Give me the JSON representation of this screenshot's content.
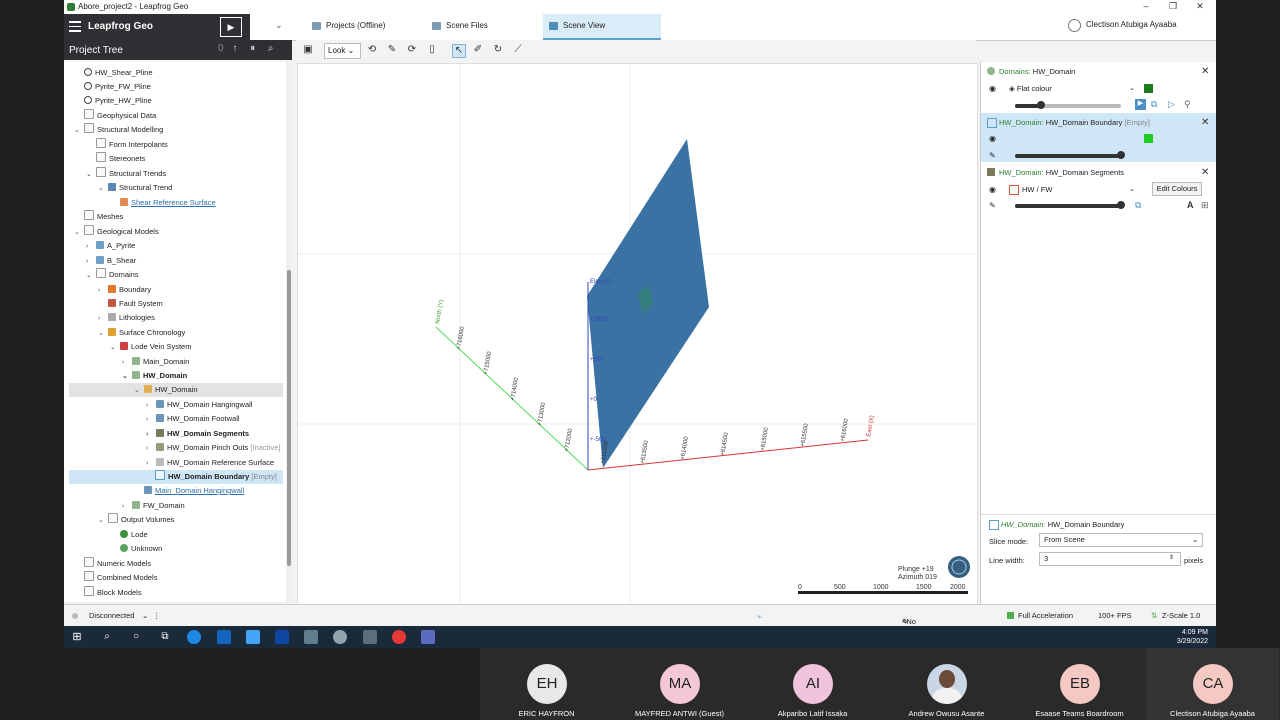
{
  "window": {
    "title": "Abore_project2 - Leapfrog Geo",
    "minimize": "–",
    "maximize": "❐",
    "close": "✕"
  },
  "header": {
    "app_name": "Leapfrog Geo",
    "tabs": [
      {
        "label": "Projects (Offline)"
      },
      {
        "label": "Scene Files"
      },
      {
        "label": "Scene View"
      }
    ],
    "user": "Clectison Atubiga Ayaaba"
  },
  "project_tree": {
    "title": "Project Tree",
    "counter": "0",
    "items": [
      {
        "label": "HW_Shear_Pline"
      },
      {
        "label": "Pyrite_FW_Pline"
      },
      {
        "label": "Pyrite_HW_Pline"
      },
      {
        "label": "Geophysical Data"
      },
      {
        "label": "Structural Modelling"
      },
      {
        "label": "Form Interpolants"
      },
      {
        "label": "Stereonets"
      },
      {
        "label": "Structural Trends"
      },
      {
        "label": "Structural Trend"
      },
      {
        "label": "Shear Reference Surface"
      },
      {
        "label": "Meshes"
      },
      {
        "label": "Geological Models"
      },
      {
        "label": "A_Pyrite"
      },
      {
        "label": "B_Shear"
      },
      {
        "label": "Domains"
      },
      {
        "label": "Boundary"
      },
      {
        "label": "Fault System"
      },
      {
        "label": "Lithologies"
      },
      {
        "label": "Surface Chronology"
      },
      {
        "label": "Lode Vein System"
      },
      {
        "label": "Main_Domain"
      },
      {
        "label": "HW_Domain"
      },
      {
        "label": "HW_Domain"
      },
      {
        "label": "HW_Domain Hangingwall"
      },
      {
        "label": "HW_Domain Footwall"
      },
      {
        "label": "HW_Domain Segments"
      },
      {
        "label": "HW_Domain Pinch Outs",
        "tag": "[Inactive]"
      },
      {
        "label": "HW_Domain Reference Surface"
      },
      {
        "label": "HW_Domain Boundary",
        "tag": "[Empty]"
      },
      {
        "label": "Main_Domain Hangingwall"
      },
      {
        "label": "FW_Domain"
      },
      {
        "label": "Output Volumes"
      },
      {
        "label": "Lode"
      },
      {
        "label": "Unknown"
      },
      {
        "label": "Numeric Models"
      },
      {
        "label": "Combined Models"
      },
      {
        "label": "Block Models"
      }
    ]
  },
  "scene": {
    "look_label": "Look",
    "axis_labels": {
      "north": "North (Y)",
      "elev": "Elev (Z)",
      "east": "East (X)"
    },
    "north_ticks": [
      "+716000",
      "+715000",
      "+714000",
      "+713000",
      "+712000",
      "+611000"
    ],
    "elev_ticks": [
      "+1000",
      "+500",
      "+0",
      "+-500"
    ],
    "east_ticks": [
      "+613500",
      "+614000",
      "+614500",
      "+615000",
      "+615500",
      "+616000"
    ],
    "plunge": "Plunge +19",
    "azimuth": "Azimuth 019",
    "scale_labels": [
      "0",
      "500",
      "1000",
      "1500",
      "2000"
    ]
  },
  "properties": {
    "layers": [
      {
        "prefix": "Domains:",
        "name": "HW_Domain",
        "mode": "Flat colour",
        "color": "#1e7a1e",
        "opacity": 0.35
      },
      {
        "prefix": "HW_Domain:",
        "name": "HW_Domain Boundary",
        "tag": "[Empty]",
        "color": "#22cc22",
        "opacity": 1.0
      },
      {
        "prefix": "HW_Domain:",
        "name": "HW_Domain Segments",
        "mode": "HW / FW",
        "button": "Edit Colours",
        "opacity": 1.0
      }
    ],
    "detail": {
      "prefix": "HW_Domain:",
      "name": "HW_Domain Boundary",
      "slice_mode_label": "Slice mode:",
      "slice_mode_value": "From Scene",
      "line_width_label": "Line width:",
      "line_width_value": "3",
      "line_width_unit": "pixels"
    }
  },
  "status": {
    "connection": "Disconnected",
    "code": "<No Code>",
    "acceleration": "Full Acceleration",
    "fps": "100+ FPS",
    "zscale": "Z-Scale 1.0"
  },
  "taskbar": {
    "time": "4:09 PM",
    "date": "3/29/2022"
  },
  "meeting": {
    "participants": [
      {
        "initials": "EH",
        "name": "ERIC HAYFRON",
        "color": "#e8e8e8"
      },
      {
        "initials": "MA",
        "name": "MAYFRED ANTWI (Guest)",
        "color": "#f3c6d8"
      },
      {
        "initials": "AI",
        "name": "Akparibo Latif Issaka",
        "color": "#f0c4dc"
      },
      {
        "initials": "",
        "name": "Andrew Owusu Asante",
        "color": "#c9d6e6"
      },
      {
        "initials": "EB",
        "name": "Esaase Teams Boardroom",
        "color": "#f4c9c4"
      },
      {
        "initials": "CA",
        "name": "Clectison Atubiga Ayaaba",
        "color": "#f4c9c4"
      }
    ]
  }
}
